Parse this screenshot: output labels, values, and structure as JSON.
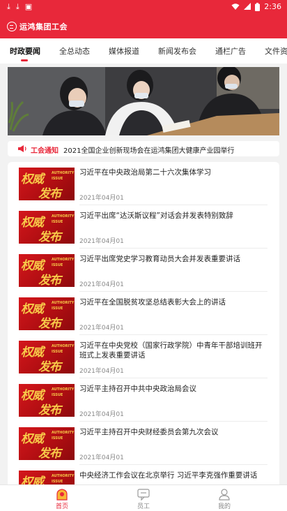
{
  "status_bar": {
    "time": "2:36",
    "left_icons": [
      "download-icon",
      "download-icon",
      "app-badge-icon"
    ],
    "right_icons": [
      "wifi-icon",
      "signal-icon",
      "battery-icon"
    ]
  },
  "app": {
    "title": "运鸿集团工会",
    "accent_color": "#e8283a"
  },
  "tabs": [
    {
      "label": "时政要闻",
      "active": true
    },
    {
      "label": "全总动态",
      "active": false
    },
    {
      "label": "媒体报道",
      "active": false
    },
    {
      "label": "新闻发布会",
      "active": false
    },
    {
      "label": "通栏广告",
      "active": false
    },
    {
      "label": "文件资",
      "active": false
    }
  ],
  "notice": {
    "tag": "工会通知",
    "text": "2021全国企业创新现场会在运鸿集团大健康产业园举行"
  },
  "thumbnail": {
    "big1": "权威",
    "big2": "发布",
    "small1": "AUTHORITY",
    "small2": "ISSUE"
  },
  "news": [
    {
      "title": "习近平在中央政治局第二十六次集体学习",
      "date": "2021年04月01"
    },
    {
      "title": "习近平出席“达沃斯议程”对话会并发表特别致辞",
      "date": "2021年04月01"
    },
    {
      "title": "习近平出席党史学习教育动员大会并发表重要讲话",
      "date": "2021年04月01"
    },
    {
      "title": "习近平在全国脱贫攻坚总结表彰大会上的讲话",
      "date": "2021年04月01"
    },
    {
      "title": "习近平在中央党校（国家行政学院）中青年干部培训班开班式上发表重要讲话",
      "date": "2021年04月01"
    },
    {
      "title": "习近平主持召开中共中央政治局会议",
      "date": "2021年04月01"
    },
    {
      "title": "习近平主持召开中央财经委员会第九次会议",
      "date": "2021年04月01"
    },
    {
      "title": "中央经济工作会议在北京举行 习近平李克强作重要讲话",
      "date": ""
    }
  ],
  "bottom_nav": [
    {
      "label": "首页",
      "icon": "home-icon",
      "active": true
    },
    {
      "label": "员工",
      "icon": "chat-icon",
      "active": false
    },
    {
      "label": "我的",
      "icon": "user-icon",
      "active": false
    }
  ]
}
